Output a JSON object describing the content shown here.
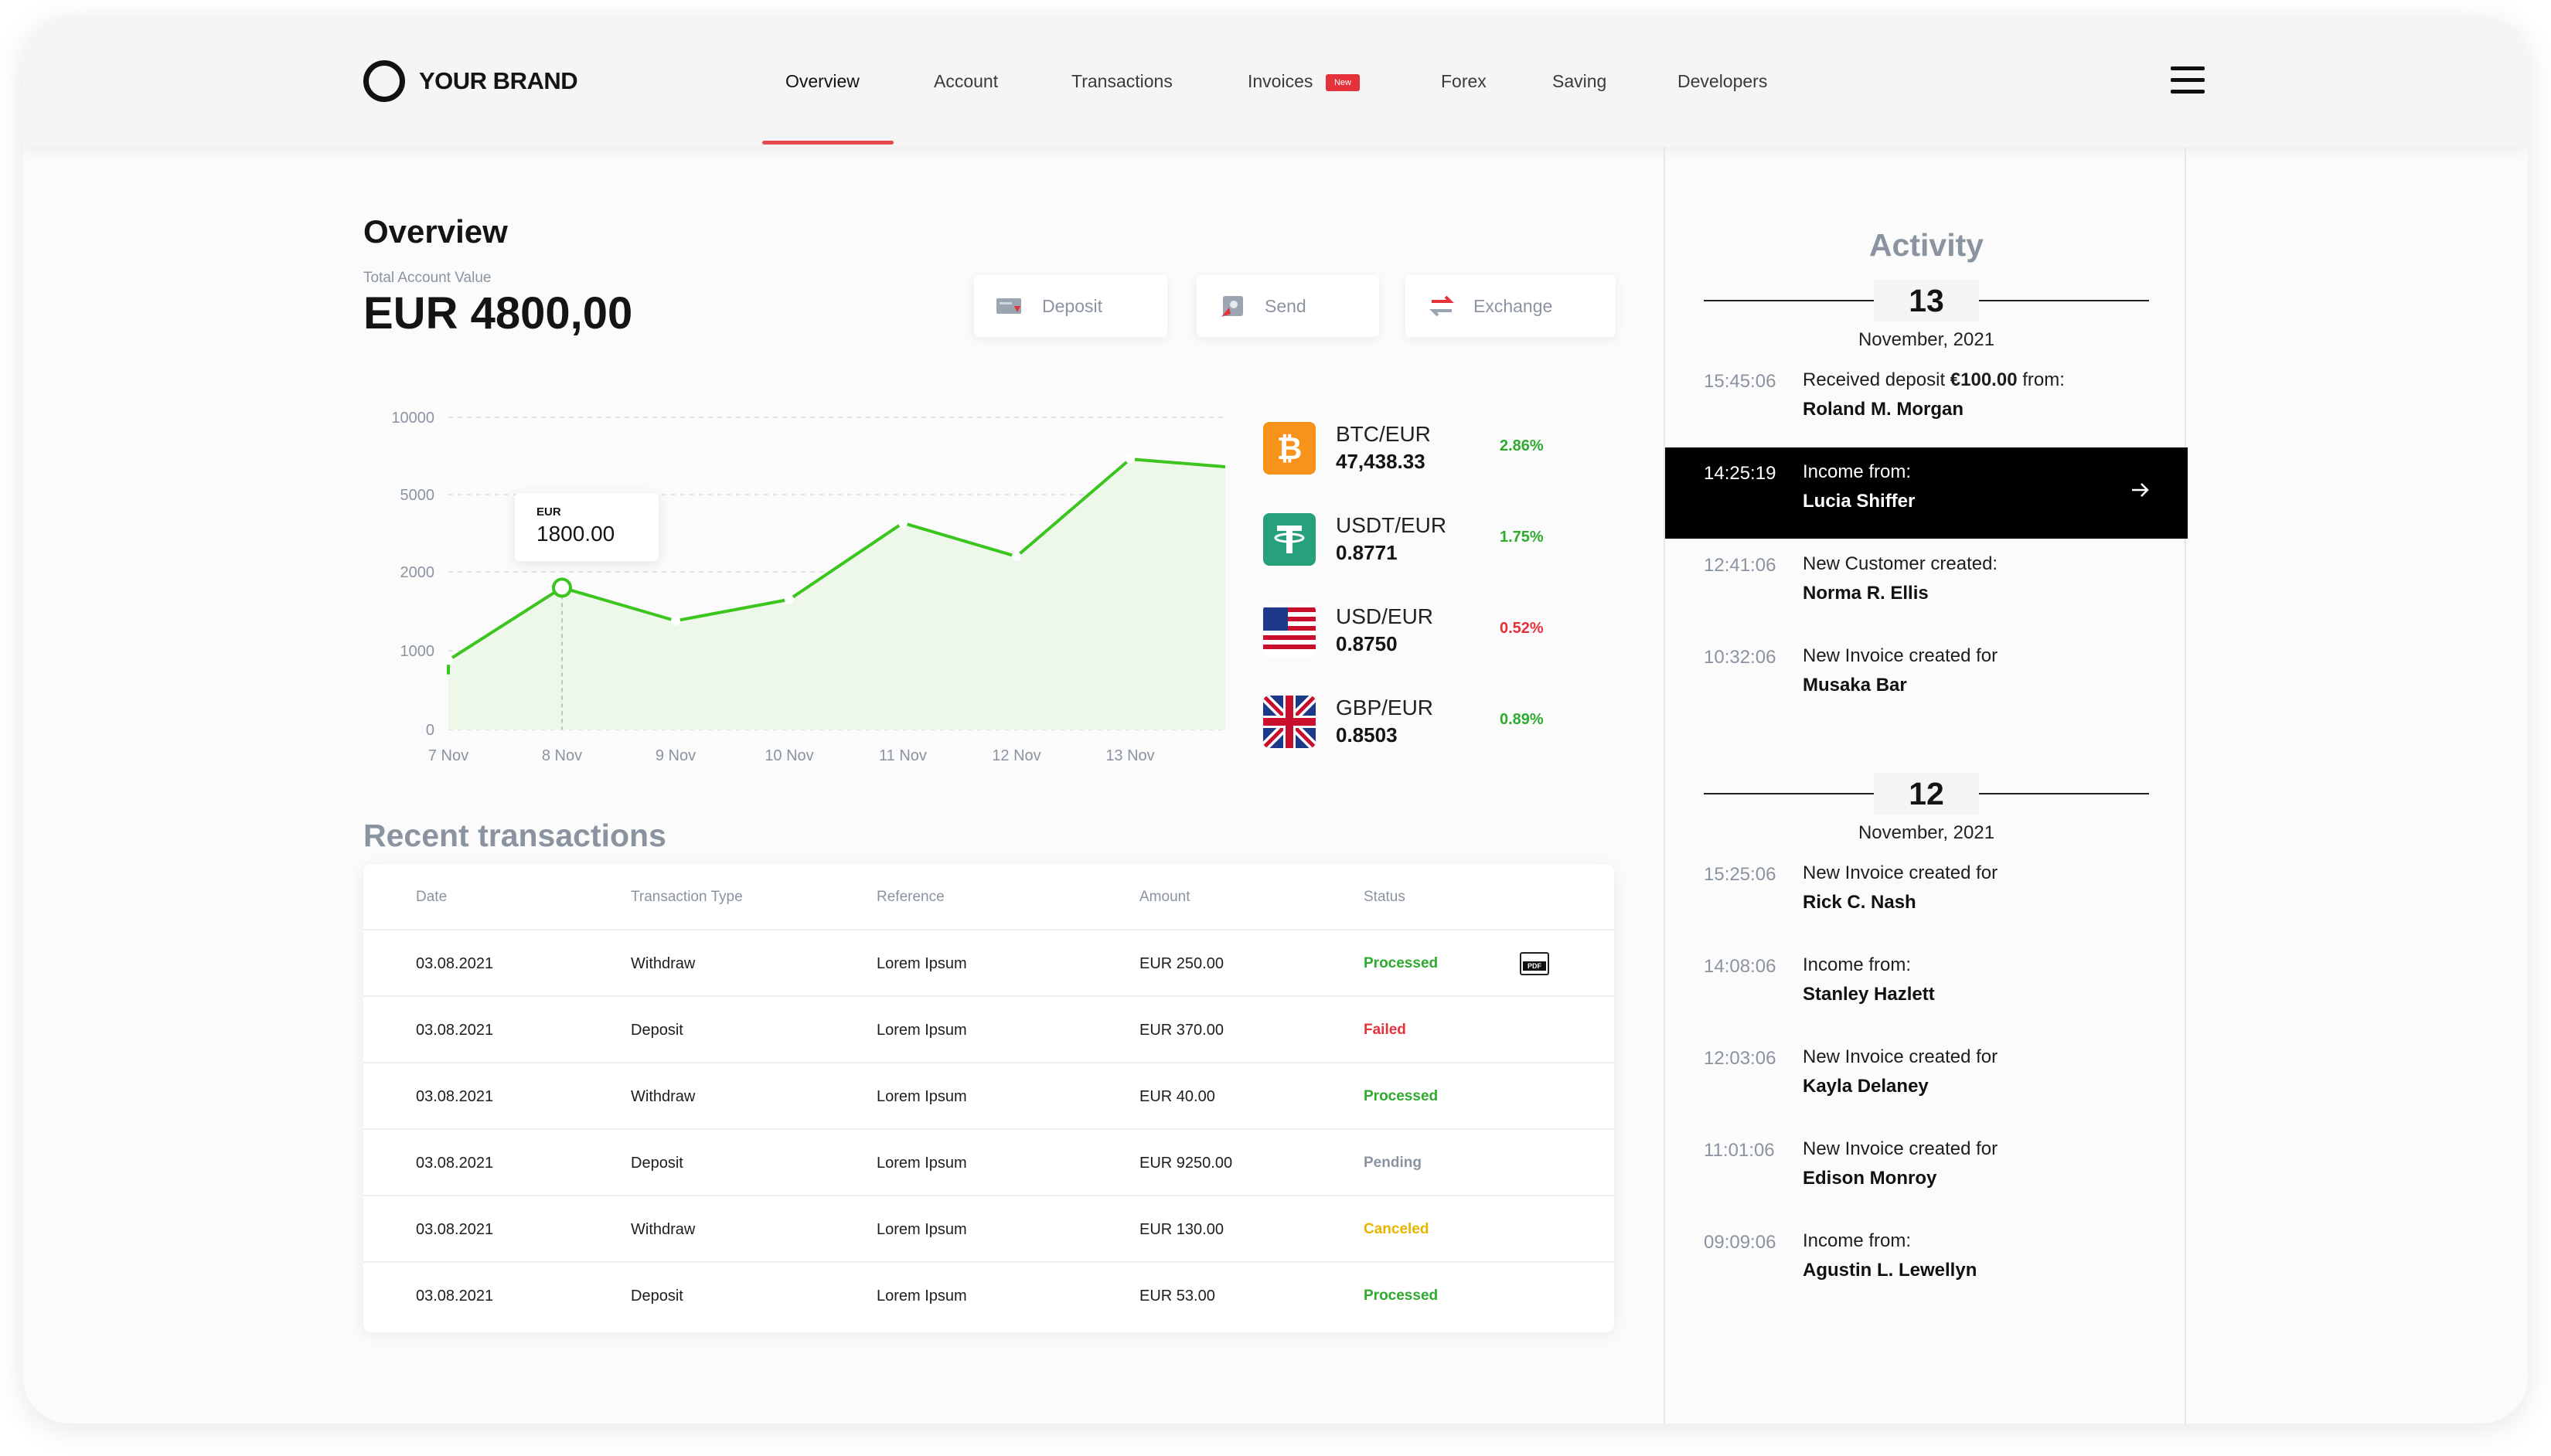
{
  "brand": {
    "name": "YOUR BRAND"
  },
  "nav": {
    "items": [
      "Overview",
      "Account",
      "Transactions",
      "Invoices",
      "Forex",
      "Saving",
      "Developers"
    ],
    "active": "Overview",
    "new_badge": "New"
  },
  "overview": {
    "title": "Overview",
    "total_label": "Total Account Value",
    "total_value": "EUR 4800,00",
    "actions": {
      "deposit": "Deposit",
      "send": "Send",
      "exchange": "Exchange"
    }
  },
  "chart_data": {
    "type": "line",
    "x": [
      "7 Nov",
      "8 Nov",
      "9 Nov",
      "10 Nov",
      "11 Nov",
      "12 Nov",
      "13 Nov"
    ],
    "y_ticks": [
      "10000",
      "5000",
      "2000",
      "1000",
      "0"
    ],
    "series": [
      {
        "values": [
          880,
          1800,
          1380,
          1650,
          3900,
          2600,
          7300
        ]
      }
    ],
    "tooltip": {
      "currency": "EUR",
      "value": "1800.00",
      "x": "8 Nov"
    },
    "grid": true,
    "colors": {
      "line": "#3cc41f",
      "fill": "#eef8ea"
    }
  },
  "rates": [
    {
      "pair": "BTC/EUR",
      "price": "47,438.33",
      "change": "2.86%",
      "direction": "up",
      "icon": "bitcoin-icon"
    },
    {
      "pair": "USDT/EUR",
      "price": "0.8771",
      "change": "1.75%",
      "direction": "up",
      "icon": "tether-icon"
    },
    {
      "pair": "USD/EUR",
      "price": "0.8750",
      "change": "0.52%",
      "direction": "down",
      "icon": "us-flag-icon"
    },
    {
      "pair": "GBP/EUR",
      "price": "0.8503",
      "change": "0.89%",
      "direction": "up",
      "icon": "uk-flag-icon"
    }
  ],
  "transactions": {
    "title": "Recent transactions",
    "headers": {
      "date": "Date",
      "type": "Transaction Type",
      "reference": "Reference",
      "amount": "Amount",
      "status": "Status"
    },
    "rows": [
      {
        "date": "03.08.2021",
        "type": "Withdraw",
        "reference": "Lorem Ipsum",
        "amount": "EUR 250.00",
        "status": "Processed"
      },
      {
        "date": "03.08.2021",
        "type": "Deposit",
        "reference": "Lorem Ipsum",
        "amount": "EUR 370.00",
        "status": "Failed"
      },
      {
        "date": "03.08.2021",
        "type": "Withdraw",
        "reference": "Lorem Ipsum",
        "amount": "EUR 40.00",
        "status": "Processed"
      },
      {
        "date": "03.08.2021",
        "type": "Deposit",
        "reference": "Lorem Ipsum",
        "amount": "EUR 9250.00",
        "status": "Pending"
      },
      {
        "date": "03.08.2021",
        "type": "Withdraw",
        "reference": "Lorem Ipsum",
        "amount": "EUR 130.00",
        "status": "Canceled"
      },
      {
        "date": "03.08.2021",
        "type": "Deposit",
        "reference": "Lorem Ipsum",
        "amount": "EUR 53.00",
        "status": "Processed"
      }
    ],
    "pdf_label": "PDF",
    "status_colors": {
      "Processed": "#2eaa2e",
      "Failed": "#e5323a",
      "Pending": "#8a94a0",
      "Canceled": "#e8b400"
    }
  },
  "activity": {
    "title": "Activity",
    "days": [
      {
        "day": "13",
        "month": "November, 2021",
        "items": [
          {
            "time": "15:45:06",
            "text_pre": "Received deposit ",
            "text_bold": "€100.00",
            "text_post": " from:",
            "name": "Roland M. Morgan"
          },
          {
            "time": "14:25:19",
            "text_pre": "Income from:",
            "text_bold": "",
            "text_post": "",
            "name": "Lucia Shiffer",
            "highlight": true
          },
          {
            "time": "12:41:06",
            "text_pre": "New Customer created:",
            "text_bold": "",
            "text_post": "",
            "name": "Norma R. Ellis"
          },
          {
            "time": "10:32:06",
            "text_pre": "New Invoice created for",
            "text_bold": "",
            "text_post": "",
            "name": "Musaka Bar"
          }
        ]
      },
      {
        "day": "12",
        "month": "November, 2021",
        "items": [
          {
            "time": "15:25:06",
            "text_pre": "New Invoice created for",
            "text_bold": "",
            "text_post": "",
            "name": "Rick C. Nash"
          },
          {
            "time": "14:08:06",
            "text_pre": "Income from:",
            "text_bold": "",
            "text_post": "",
            "name": "Stanley Hazlett"
          },
          {
            "time": "12:03:06",
            "text_pre": "New Invoice created for",
            "text_bold": "",
            "text_post": "",
            "name": "Kayla Delaney"
          },
          {
            "time": "11:01:06",
            "text_pre": "New Invoice created for",
            "text_bold": "",
            "text_post": "",
            "name": "Edison Monroy"
          },
          {
            "time": "09:09:06",
            "text_pre": "Income from:",
            "text_bold": "",
            "text_post": "",
            "name": "Agustin L. Lewellyn"
          }
        ]
      }
    ]
  }
}
